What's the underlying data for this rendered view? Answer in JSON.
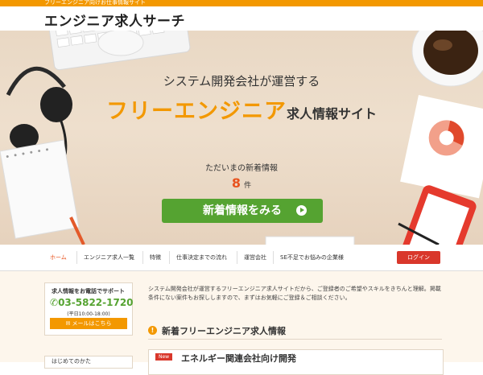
{
  "topbar": {
    "tagline": "フリーエンジニア向けお仕事情報サイト"
  },
  "header": {
    "title": "エンジニア求人サーチ"
  },
  "hero": {
    "subtitle": "システム開発会社が運営する",
    "main_orange": "フリーエンジニア",
    "main_dark": "求人情報サイト",
    "new_label": "ただいまの新着情報",
    "count": "8",
    "count_unit": "件",
    "cta": "新着情報をみる"
  },
  "nav": {
    "items": [
      "ホーム",
      "エンジニア求人一覧",
      "特徴",
      "仕事決定までの流れ",
      "運営会社",
      "SE不足でお悩みの企業様"
    ],
    "login": "ログイン"
  },
  "sidebar": {
    "contact_title": "求人情報をお電話でサポート",
    "phone": "03-5822-1720",
    "hours": "(平日10:00-18:00)",
    "mail_button": "メールはこちら",
    "beginner_title": "はじめてのかた"
  },
  "main": {
    "intro": "システム開発会社が運営するフリーエンジニア求人サイトだから、ご登録者のご希望やスキルをきちんと理解。掲載条件にない案件もお探ししますので、まずはお気軽にご登録＆ご相談ください。",
    "section_title": "新着フリーエンジニア求人情報",
    "job_badge": "New",
    "job_title": "エネルギー関連会社向け開発"
  },
  "colors": {
    "accent": "#f39800",
    "green": "#55a331",
    "red": "#d9372b"
  }
}
